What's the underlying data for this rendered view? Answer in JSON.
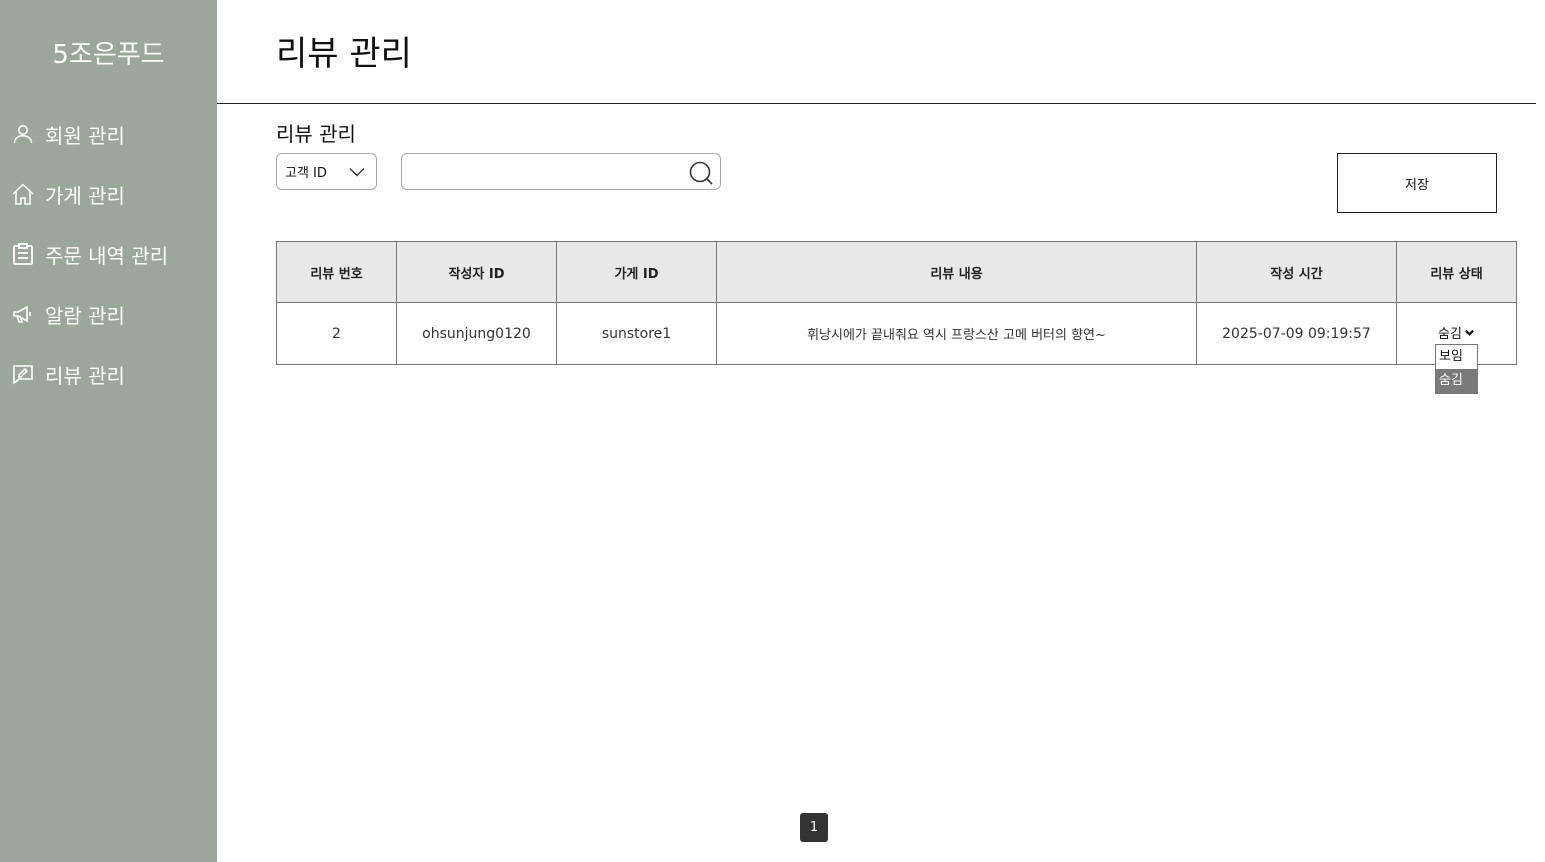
{
  "sidebar": {
    "brand": "5조은푸드",
    "items": [
      {
        "label": "회원 관리",
        "icon": "user-icon"
      },
      {
        "label": "가게 관리",
        "icon": "house-icon"
      },
      {
        "label": "주문 내역 관리",
        "icon": "clipboard-icon"
      },
      {
        "label": "알람 관리",
        "icon": "megaphone-icon"
      },
      {
        "label": "리뷰 관리",
        "icon": "review-icon"
      }
    ]
  },
  "header": {
    "title": "리뷰 관리"
  },
  "filter": {
    "section_label": "리뷰 관리",
    "select_value": "고객 ID",
    "search_value": "",
    "save_label": "저장"
  },
  "table": {
    "headers": [
      "리뷰 번호",
      "작성자 ID",
      "가게 ID",
      "리뷰 내용",
      "작성 시간",
      "리뷰 상태"
    ],
    "rows": [
      {
        "review_no": "2",
        "author_id": "ohsunjung0120",
        "store_id": "sunstore1",
        "content": "휘낭시에가 끝내줘요 역시 프랑스산 고메 버터의 향연~",
        "created_at": "2025-07-09 09:19:57",
        "status": "숨김"
      }
    ]
  },
  "status_dropdown": {
    "options": [
      "보임",
      "숨김"
    ],
    "selected": "숨김"
  },
  "pagination": {
    "current_page": "1"
  }
}
